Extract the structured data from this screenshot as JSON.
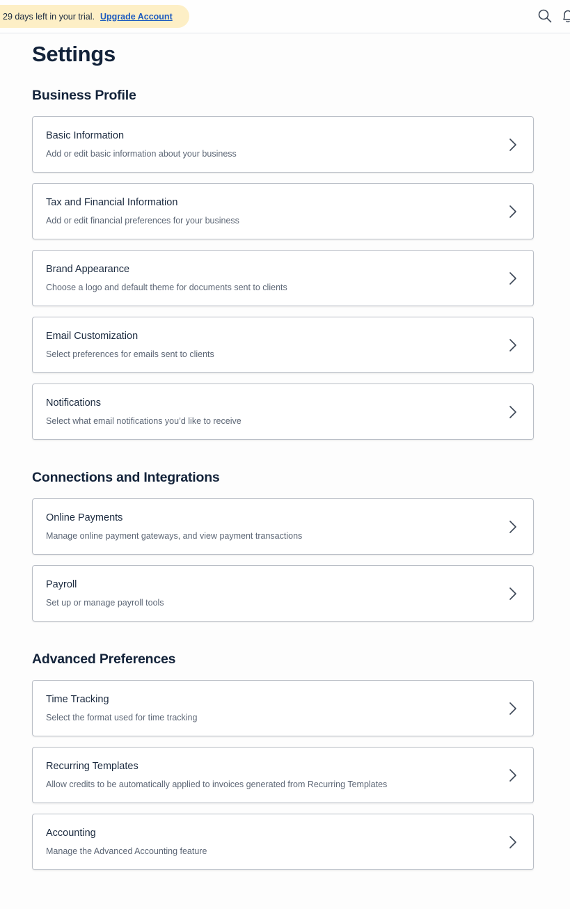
{
  "topbar": {
    "trial_text": "29 days left in your trial.",
    "upgrade_label": "Upgrade Account",
    "icons": [
      "search-icon",
      "bell-icon"
    ],
    "pill_color": "#fdefc6",
    "link_color": "#1d5bbf"
  },
  "page_title": "Settings",
  "sections": [
    {
      "title": "Business Profile",
      "items": [
        {
          "title": "Basic Information",
          "desc": "Add or edit basic information about your business"
        },
        {
          "title": "Tax and Financial Information",
          "desc": "Add or edit financial preferences for your business"
        },
        {
          "title": "Brand Appearance",
          "desc": "Choose a logo and default theme for documents sent to clients"
        },
        {
          "title": "Email Customization",
          "desc": "Select preferences for emails sent to clients"
        },
        {
          "title": "Notifications",
          "desc": "Select what email notifications you’d like to receive"
        }
      ]
    },
    {
      "title": "Connections and Integrations",
      "items": [
        {
          "title": "Online Payments",
          "desc": "Manage online payment gateways, and view payment transactions"
        },
        {
          "title": "Payroll",
          "desc": "Set up or manage payroll tools"
        }
      ]
    },
    {
      "title": "Advanced Preferences",
      "items": [
        {
          "title": "Time Tracking",
          "desc": "Select the format used for time tracking"
        },
        {
          "title": "Recurring Templates",
          "desc": "Allow credits to be automatically applied to invoices generated from Recurring Templates"
        },
        {
          "title": "Accounting",
          "desc": "Manage the Advanced Accounting feature"
        }
      ]
    }
  ]
}
